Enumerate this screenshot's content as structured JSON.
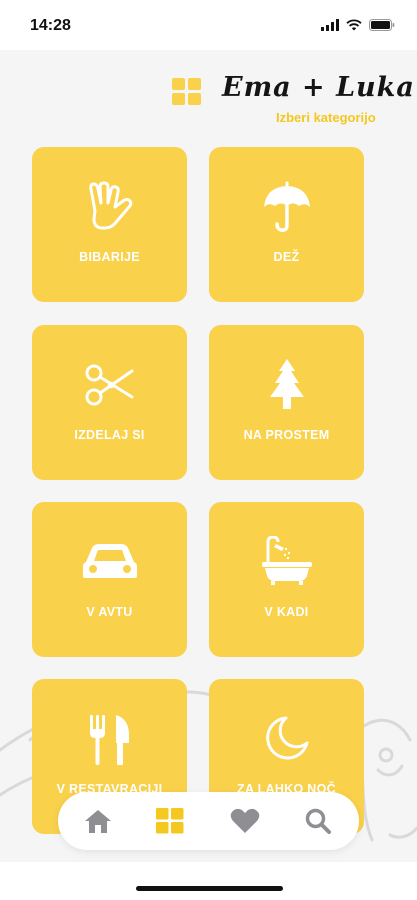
{
  "status_bar": {
    "time": "14:28",
    "icons": [
      "signal-icon",
      "wifi-icon",
      "battery-icon"
    ]
  },
  "header": {
    "title": "Ema + Luka",
    "subtitle": "Izberi kategorijo",
    "logo_icon": "grid-icon"
  },
  "categories": [
    {
      "label": "BIBARIJE",
      "icon": "hand-icon"
    },
    {
      "label": "DEŽ",
      "icon": "umbrella-icon"
    },
    {
      "label": "IZDELAJ SI",
      "icon": "scissors-icon"
    },
    {
      "label": "NA PROSTEM",
      "icon": "tree-icon"
    },
    {
      "label": "V AVTU",
      "icon": "car-icon"
    },
    {
      "label": "V KADI",
      "icon": "bathtub-icon"
    },
    {
      "label": "V RESTAVRACIJI",
      "icon": "cutlery-icon"
    },
    {
      "label": "ZA LAHKO NOČ",
      "icon": "moon-icon"
    }
  ],
  "bottom_nav": [
    "home-icon",
    "grid-icon",
    "heart-icon",
    "search-icon"
  ],
  "colors": {
    "accent": "#f9d14b",
    "subtitle": "#f4c81e",
    "nav_active": "#f4c81e",
    "nav_inactive": "#8e8e93",
    "background": "#f5f5f6"
  }
}
